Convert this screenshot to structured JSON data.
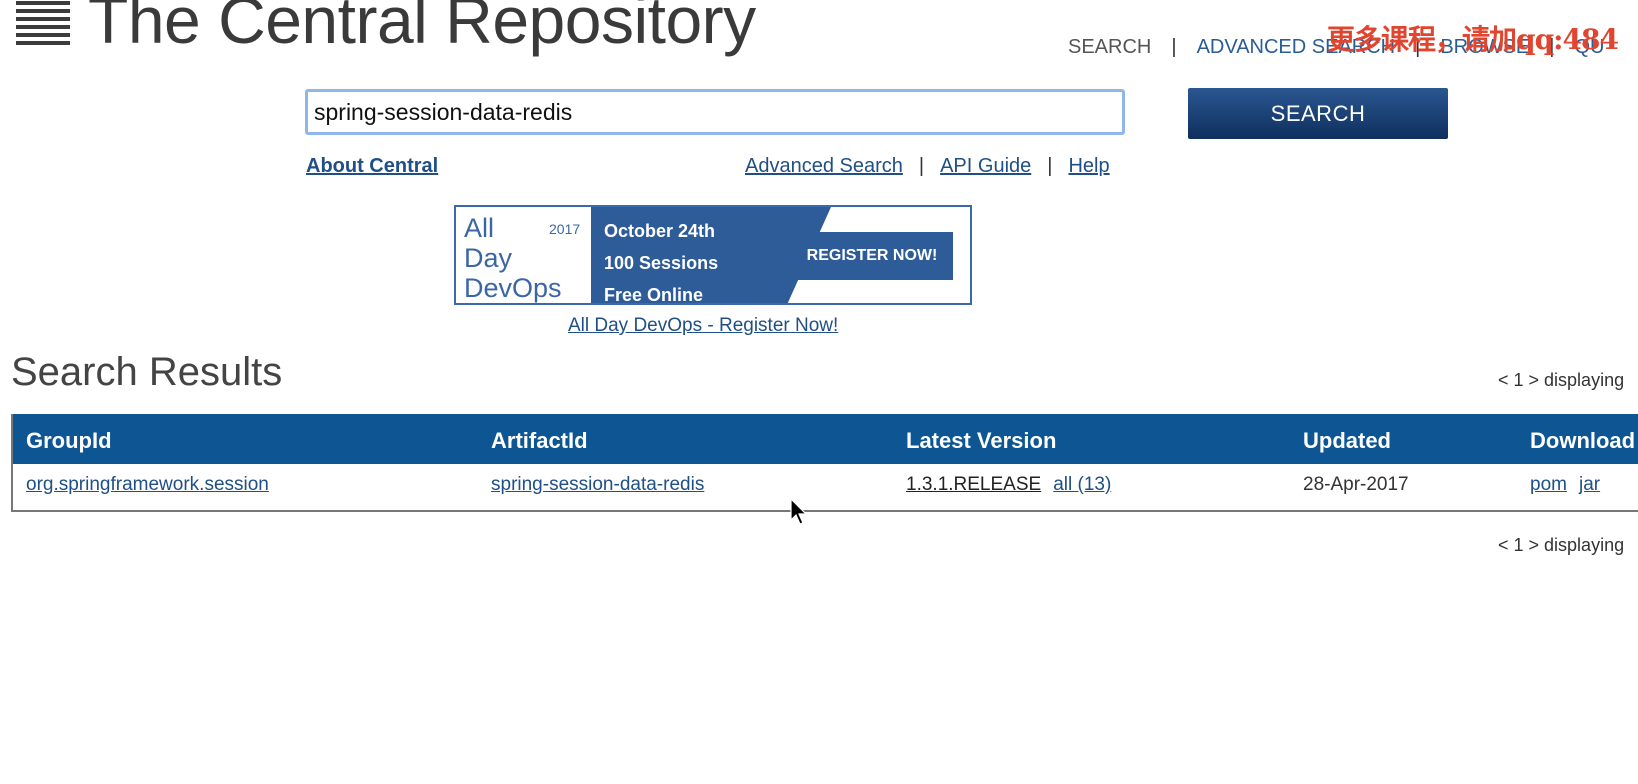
{
  "header": {
    "logo_text": "The Central Repository",
    "nav": [
      "SEARCH",
      "ADVANCED SEARCH",
      "BROWSE",
      "QU"
    ],
    "watermark": "更多课程，请加qq:484"
  },
  "search": {
    "value": "spring-session-data-redis",
    "button_label": "SEARCH"
  },
  "links": {
    "about": "About Central",
    "advanced": "Advanced Search",
    "api": "API Guide",
    "help": "Help"
  },
  "banner": {
    "logo_lines": [
      "All",
      "Day",
      "DevOps"
    ],
    "year": "2017",
    "lines": [
      "October 24th",
      "100 Sessions",
      "Free Online"
    ],
    "button": "REGISTER NOW!",
    "link": "All Day DevOps - Register Now!"
  },
  "results": {
    "title": "Search Results",
    "pager": "< 1 > displaying",
    "columns": [
      "GroupId",
      "ArtifactId",
      "Latest Version",
      "Updated",
      "Download"
    ],
    "rows": [
      {
        "group": "org.springframework.session",
        "artifact": "spring-session-data-redis",
        "version": "1.3.1.RELEASE",
        "all": "all (13)",
        "updated": "28-Apr-2017",
        "downloads": [
          "pom",
          "jar"
        ]
      }
    ]
  }
}
